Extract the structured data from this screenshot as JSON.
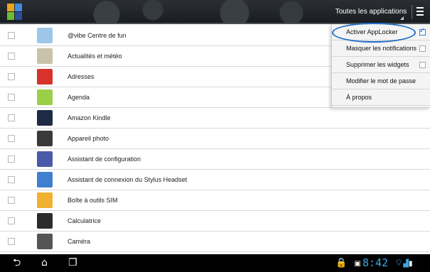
{
  "topbar": {
    "app_logo": "applocker-logo",
    "filter_tab_label": "Toutes les applications",
    "menu_icon": "overflow-menu-icon"
  },
  "apps": [
    {
      "name": "@vibe Centre de fun",
      "icon": "vibe-icon",
      "color": "#9ec6e8",
      "checked": false
    },
    {
      "name": "Actualités et météo",
      "icon": "news-weather-icon",
      "color": "#c9c2a8",
      "checked": false
    },
    {
      "name": "Adresses",
      "icon": "map-pin-icon",
      "color": "#d7322b",
      "checked": false
    },
    {
      "name": "Agenda",
      "icon": "calendar-icon",
      "color": "#9bcf4a",
      "checked": false
    },
    {
      "name": "Amazon Kindle",
      "icon": "kindle-icon",
      "color": "#1f2a44",
      "checked": false
    },
    {
      "name": "Appareil photo",
      "icon": "camera-icon",
      "color": "#3a3a3a",
      "checked": false
    },
    {
      "name": "Assistant de configuration",
      "icon": "setup-wizard-icon",
      "color": "#4a5aa8",
      "checked": false
    },
    {
      "name": "Assistant de connexion du Stylus Headset",
      "icon": "bluetooth-headset-icon",
      "color": "#3f7fd0",
      "checked": false
    },
    {
      "name": "Boîte à outils SIM",
      "icon": "sim-toolkit-icon",
      "color": "#f0b030",
      "checked": false
    },
    {
      "name": "Calculatrice",
      "icon": "calculator-icon",
      "color": "#2c2c2c",
      "checked": false
    },
    {
      "name": "Caméra",
      "icon": "webcam-icon",
      "color": "#555555",
      "checked": false
    },
    {
      "name": "",
      "icon": "partial-app-icon",
      "color": "#e0403a",
      "checked": false
    }
  ],
  "menu": {
    "items": [
      {
        "label": "Activer AppLocker",
        "has_checkbox": true,
        "checked": true
      },
      {
        "label": "Masquer les notifications",
        "has_checkbox": true,
        "checked": false
      },
      {
        "label": "Supprimer les widgets",
        "has_checkbox": true,
        "checked": false
      },
      {
        "label": "Modifier le mot de passe",
        "has_checkbox": false,
        "checked": false
      },
      {
        "label": "À propos",
        "has_checkbox": false,
        "checked": false
      }
    ],
    "highlight_color": "#1f6cc7"
  },
  "navbar": {
    "back_icon": "back-icon",
    "home_icon": "home-icon",
    "recents_icon": "recent-apps-icon",
    "clock": "8:42",
    "status_icons": [
      "lock-icon",
      "screenshot-icon",
      "wifi-icon",
      "signal-icon",
      "battery-icon"
    ],
    "accent": "#3fa6e6"
  }
}
